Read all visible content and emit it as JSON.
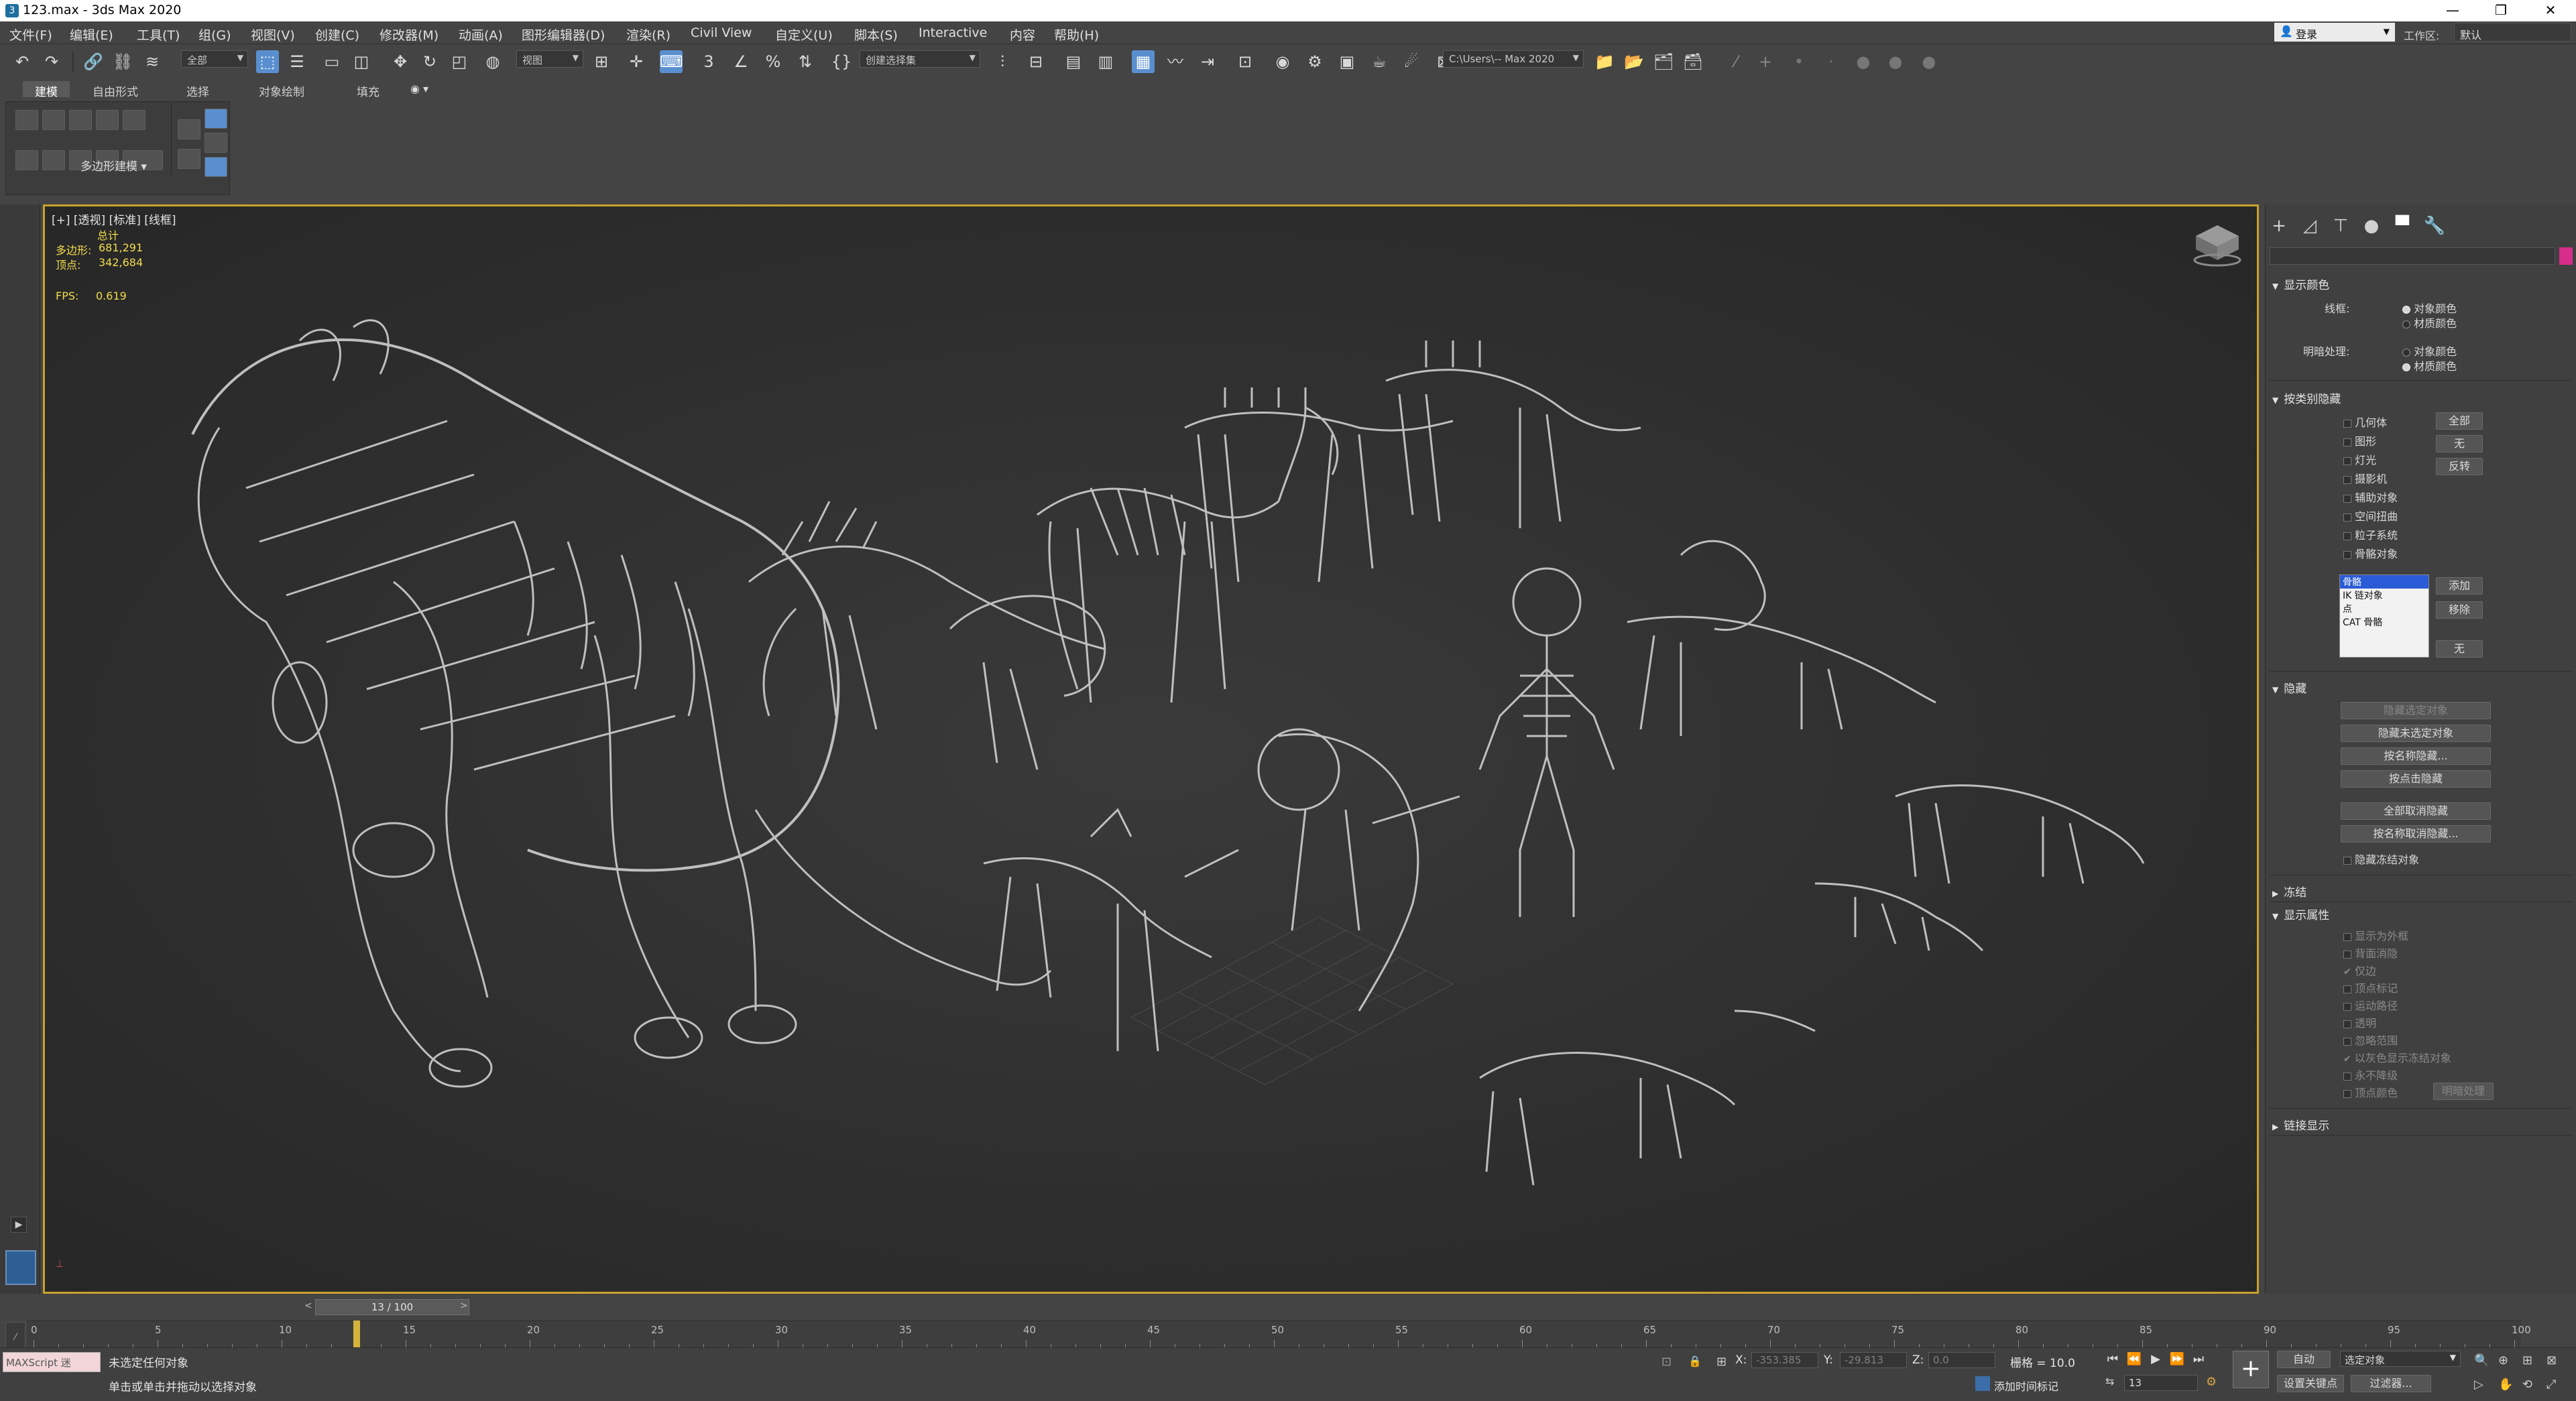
{
  "window": {
    "title": "123.max - 3ds Max 2020",
    "controls": [
      "—",
      "❐",
      "✕"
    ]
  },
  "menubar": {
    "items": [
      "文件(F)",
      "编辑(E)",
      "工具(T)",
      "组(G)",
      "视图(V)",
      "创建(C)",
      "修改器(M)",
      "动画(A)",
      "图形编辑器(D)",
      "渲染(R)",
      "Civil View",
      "自定义(U)",
      "脚本(S)",
      "Interactive",
      "内容",
      "帮助(H)"
    ],
    "login": "登录",
    "workspace_label": "工作区:",
    "workspace_value": "默认"
  },
  "toolbar": {
    "filter_dropdown": "全部",
    "ref_coord_dropdown": "视图",
    "selection_set_dropdown": "创建选择集",
    "path_dropdown": "C:\\Users\\-- Max 2020"
  },
  "ribbon": {
    "tabs": [
      "建模",
      "自由形式",
      "选择",
      "对象绘制",
      "填充"
    ],
    "panel_label": "多边形建模 ▾"
  },
  "viewport": {
    "label": "[+] [透视] [标准] [线框]",
    "stats": {
      "total_label": "总计",
      "polys_label": "多边形:",
      "polys_value": "681,291",
      "verts_label": "顶点:",
      "verts_value": "342,684",
      "fps_label": "FPS:",
      "fps_value": "0.619"
    }
  },
  "command_panel": {
    "display_color": {
      "header": "显示颜色",
      "wireframe_label": "线框:",
      "shaded_label": "明暗处理:",
      "opt_object_color": "对象颜色",
      "opt_material_color": "材质颜色"
    },
    "hide_by_category": {
      "header": "按类别隐藏",
      "categories": [
        "几何体",
        "图形",
        "灯光",
        "摄影机",
        "辅助对象",
        "空间扭曲",
        "粒子系统",
        "骨骼对象"
      ],
      "btn_all": "全部",
      "btn_none": "无",
      "btn_invert": "反转",
      "list_items": [
        "骨骼",
        "IK 链对象",
        "点",
        "CAT 骨骼"
      ],
      "btn_add": "添加",
      "btn_remove": "移除",
      "btn_none2": "无"
    },
    "hide": {
      "header": "隐藏",
      "btn_hide_selected": "隐藏选定对象",
      "btn_hide_unselected": "隐藏未选定对象",
      "btn_hide_by_name": "按名称隐藏...",
      "btn_hide_by_hit": "按点击隐藏",
      "btn_unhide_all": "全部取消隐藏",
      "btn_unhide_by_name": "按名称取消隐藏...",
      "chk_hide_frozen": "隐藏冻结对象"
    },
    "freeze": {
      "header": "冻结"
    },
    "display_props": {
      "header": "显示属性",
      "items": [
        "显示为外框",
        "背面消隐",
        "仅边",
        "顶点标记",
        "运动路径",
        "透明",
        "忽略范围",
        "以灰色显示冻结对象",
        "永不降级",
        "顶点颜色"
      ],
      "btn_shaded": "明暗处理"
    },
    "link_display": {
      "header": "链接显示"
    }
  },
  "timeline": {
    "slider_label": "13 / 100",
    "ticks": [
      "0",
      "5",
      "10",
      "15",
      "20",
      "25",
      "30",
      "35",
      "40",
      "45",
      "50",
      "55",
      "60",
      "65",
      "70",
      "75",
      "80",
      "85",
      "90",
      "95",
      "100"
    ],
    "current_frame_fraction": 0.13
  },
  "statusbar": {
    "script_label": "MAXScript 迷",
    "status_line1": "未选定任何对象",
    "status_line2": "单击或单击并拖动以选择对象",
    "x_label": "X:",
    "x_value": "-353.385",
    "y_label": "Y:",
    "y_value": "-29.813",
    "z_label": "Z:",
    "z_value": "0.0",
    "grid_label": "栅格 = 10.0",
    "add_time_tag": "添加时间标记",
    "auto_key": "自动",
    "selected_objects": "选定对象",
    "set_key": "设置关键点",
    "key_filters": "过滤器...",
    "frame_value": "13"
  }
}
